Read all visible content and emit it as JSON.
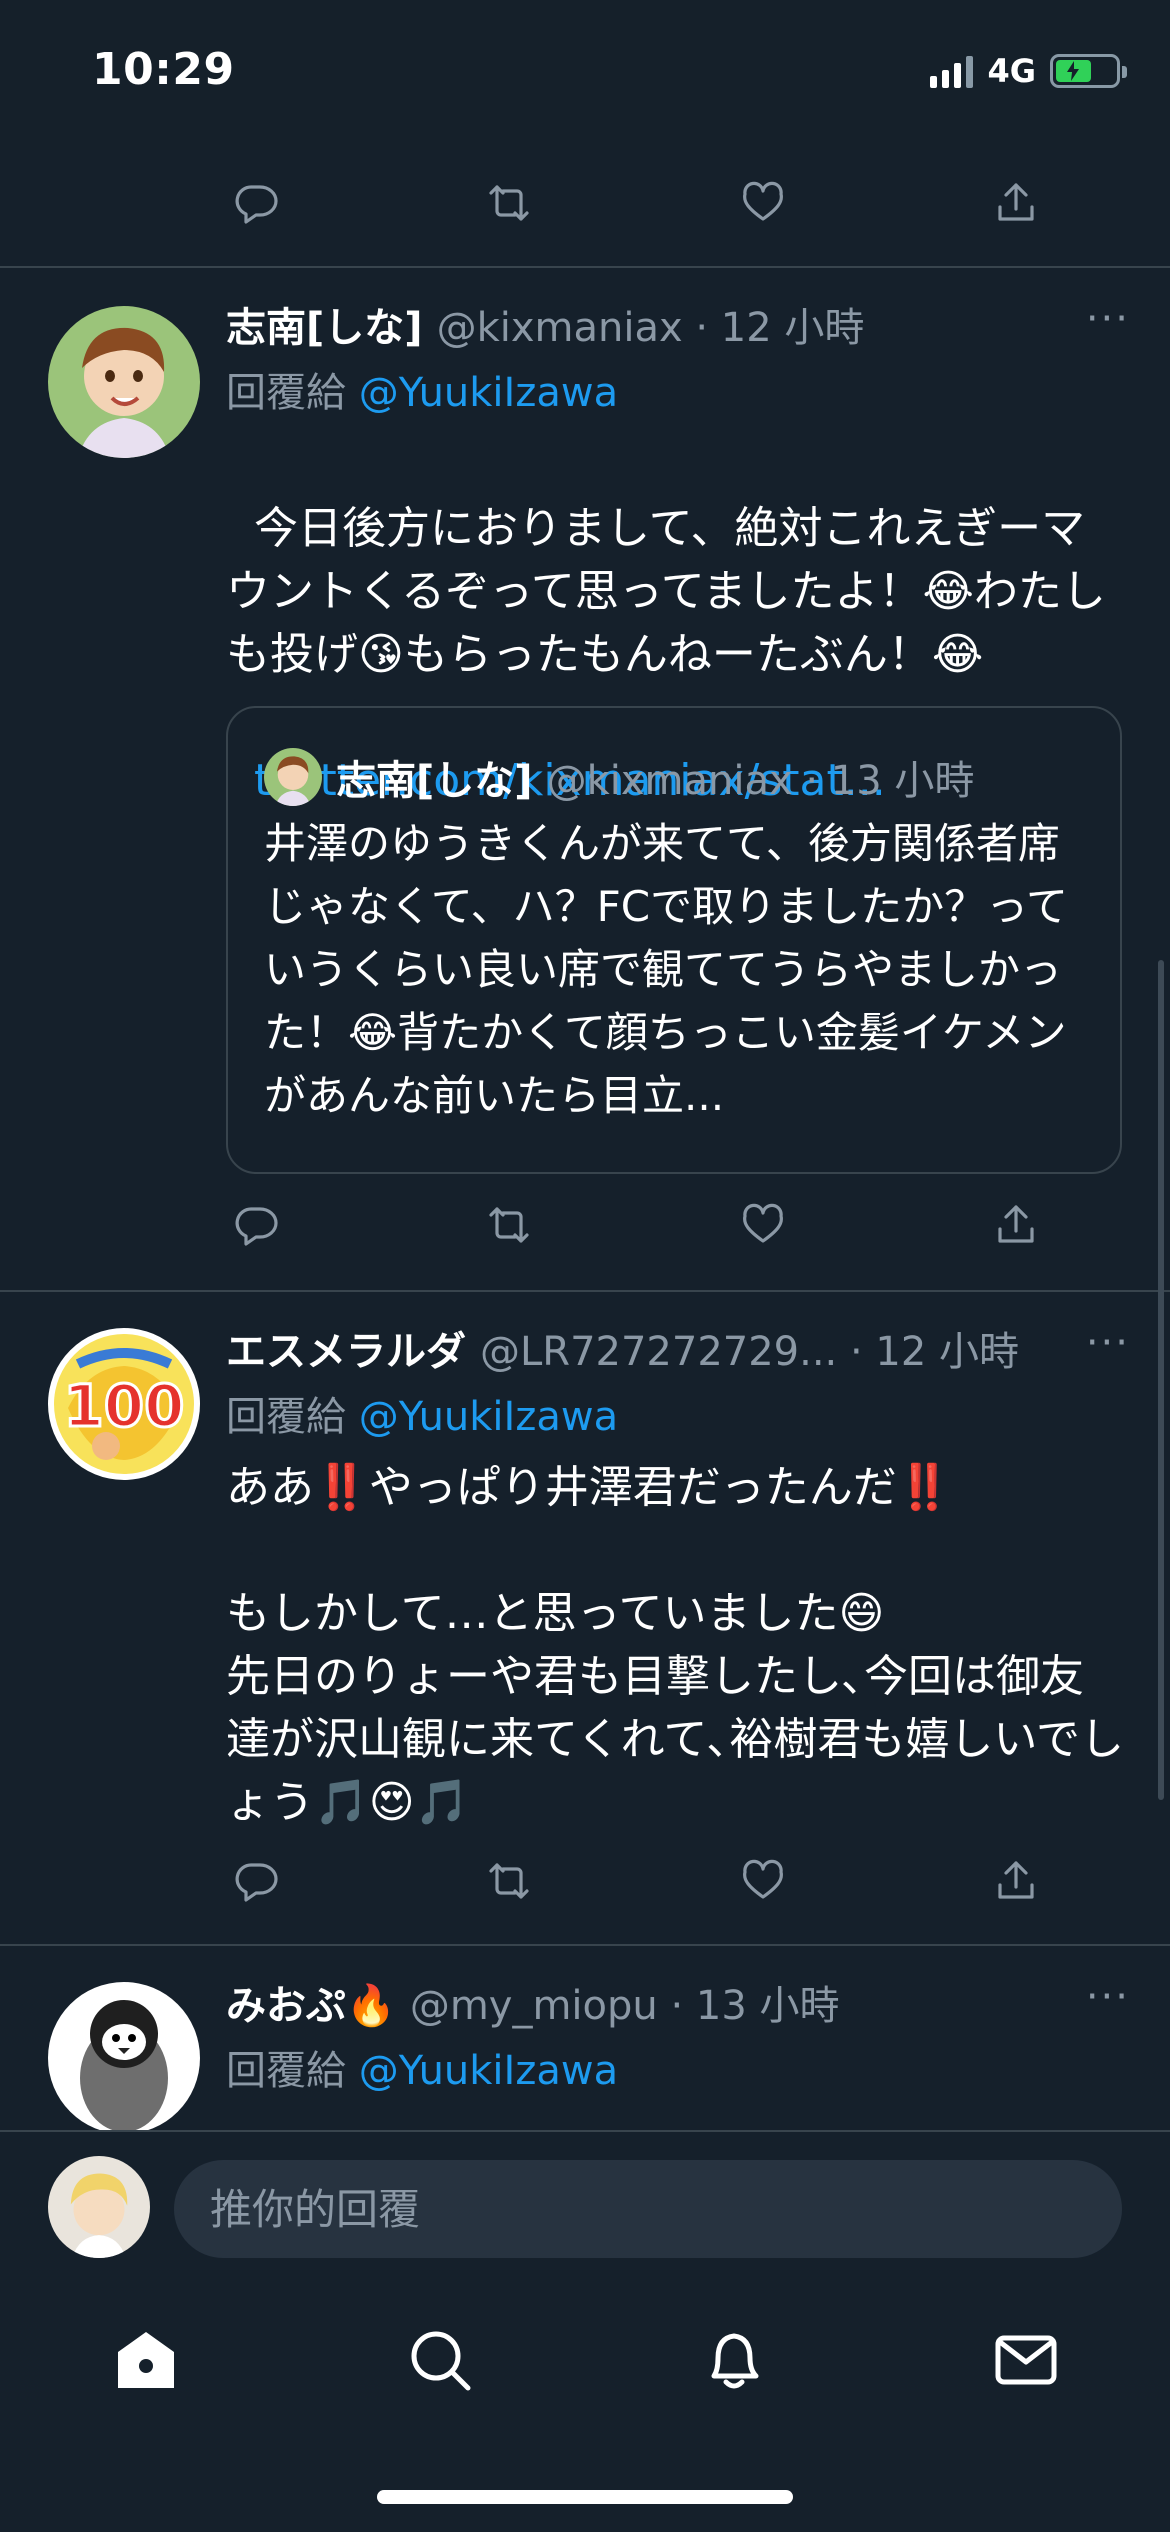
{
  "status_bar": {
    "time": "10:29",
    "network": "4G"
  },
  "tweets": [
    {
      "name": "志南[しな]",
      "handle": "@kixmaniax · 12 小時",
      "reply_prefix": "回覆給 ",
      "reply_to": "@YuukiIzawa",
      "text": "今日後方におりまして、絶対これえぎーマウントくるぞって思ってましたよ！😂わたしも投げ😘もらったもんねーたぶん！😂",
      "link": "twitter.com/kixmaniax/stat...",
      "quote": {
        "name": "志南[しな]",
        "handle": "@kixmaniax · 13 小時",
        "text": "井澤のゆうきくんが来てて、後方関係者席じゃなくて、ハ？FCで取りましたか？っていうくらい良い席で観ててうらやましかった！😂背たかくて顔ちっこい金髪イケメンがあんな前いたら目立..."
      }
    },
    {
      "name": "エスメラルダ",
      "handle": "@LR727272729... · 12 小時",
      "reply_prefix": "回覆給 ",
      "reply_to": "@YuukiIzawa",
      "text": "ああ‼️やっぱり井澤君だったんだ‼️\n\nもしかして…と思っていました😄\n先日のりょーや君も目撃したし､今回は御友達が沢山観に来てくれて､裕樹君も嬉しいでしょう🎵😍🎵"
    },
    {
      "name": "みおぷ🔥",
      "handle": "@my_miopu · 13 小時",
      "reply_prefix": "回覆給 ",
      "reply_to": "@YuukiIzawa"
    }
  ],
  "more_label": "···",
  "reply_input": {
    "placeholder": "推你的回覆"
  },
  "icons": [
    "reply-icon",
    "retweet-icon",
    "like-icon",
    "share-icon",
    "home-icon",
    "search-icon",
    "notifications-icon",
    "messages-icon"
  ],
  "colors": {
    "background": "#15202b",
    "link": "#1d9bf0",
    "muted": "#8b98a5",
    "divider": "#38444d"
  }
}
